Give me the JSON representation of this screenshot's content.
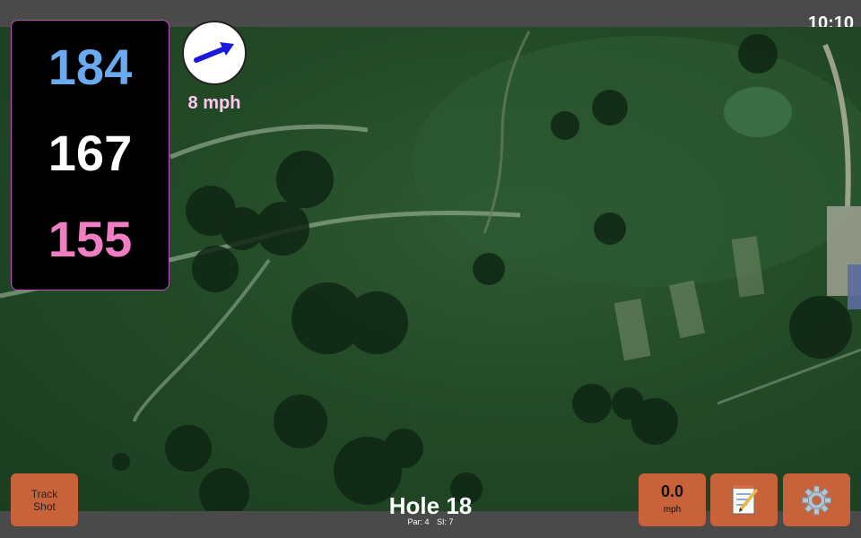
{
  "status": {
    "time": "10:10"
  },
  "distances": {
    "back": "184",
    "middle": "167",
    "front": "155"
  },
  "wind": {
    "speed_label": "8 mph",
    "arrow_color": "#1a1adf"
  },
  "hole": {
    "title": "Hole 18",
    "par_label": "Par: 4",
    "si_label": "SI: 7"
  },
  "buttons": {
    "track_line1": "Track",
    "track_line2": "Shot",
    "speed_value": "0.0",
    "speed_unit": "mph",
    "notes_icon": "notepad-icon",
    "settings_icon": "gear-icon"
  },
  "colors": {
    "button_bg": "#c8623a",
    "back_distance": "#6aaaf0",
    "middle_distance": "#ffffff",
    "front_distance": "#f07ec2",
    "panel_border": "#c050c0"
  }
}
